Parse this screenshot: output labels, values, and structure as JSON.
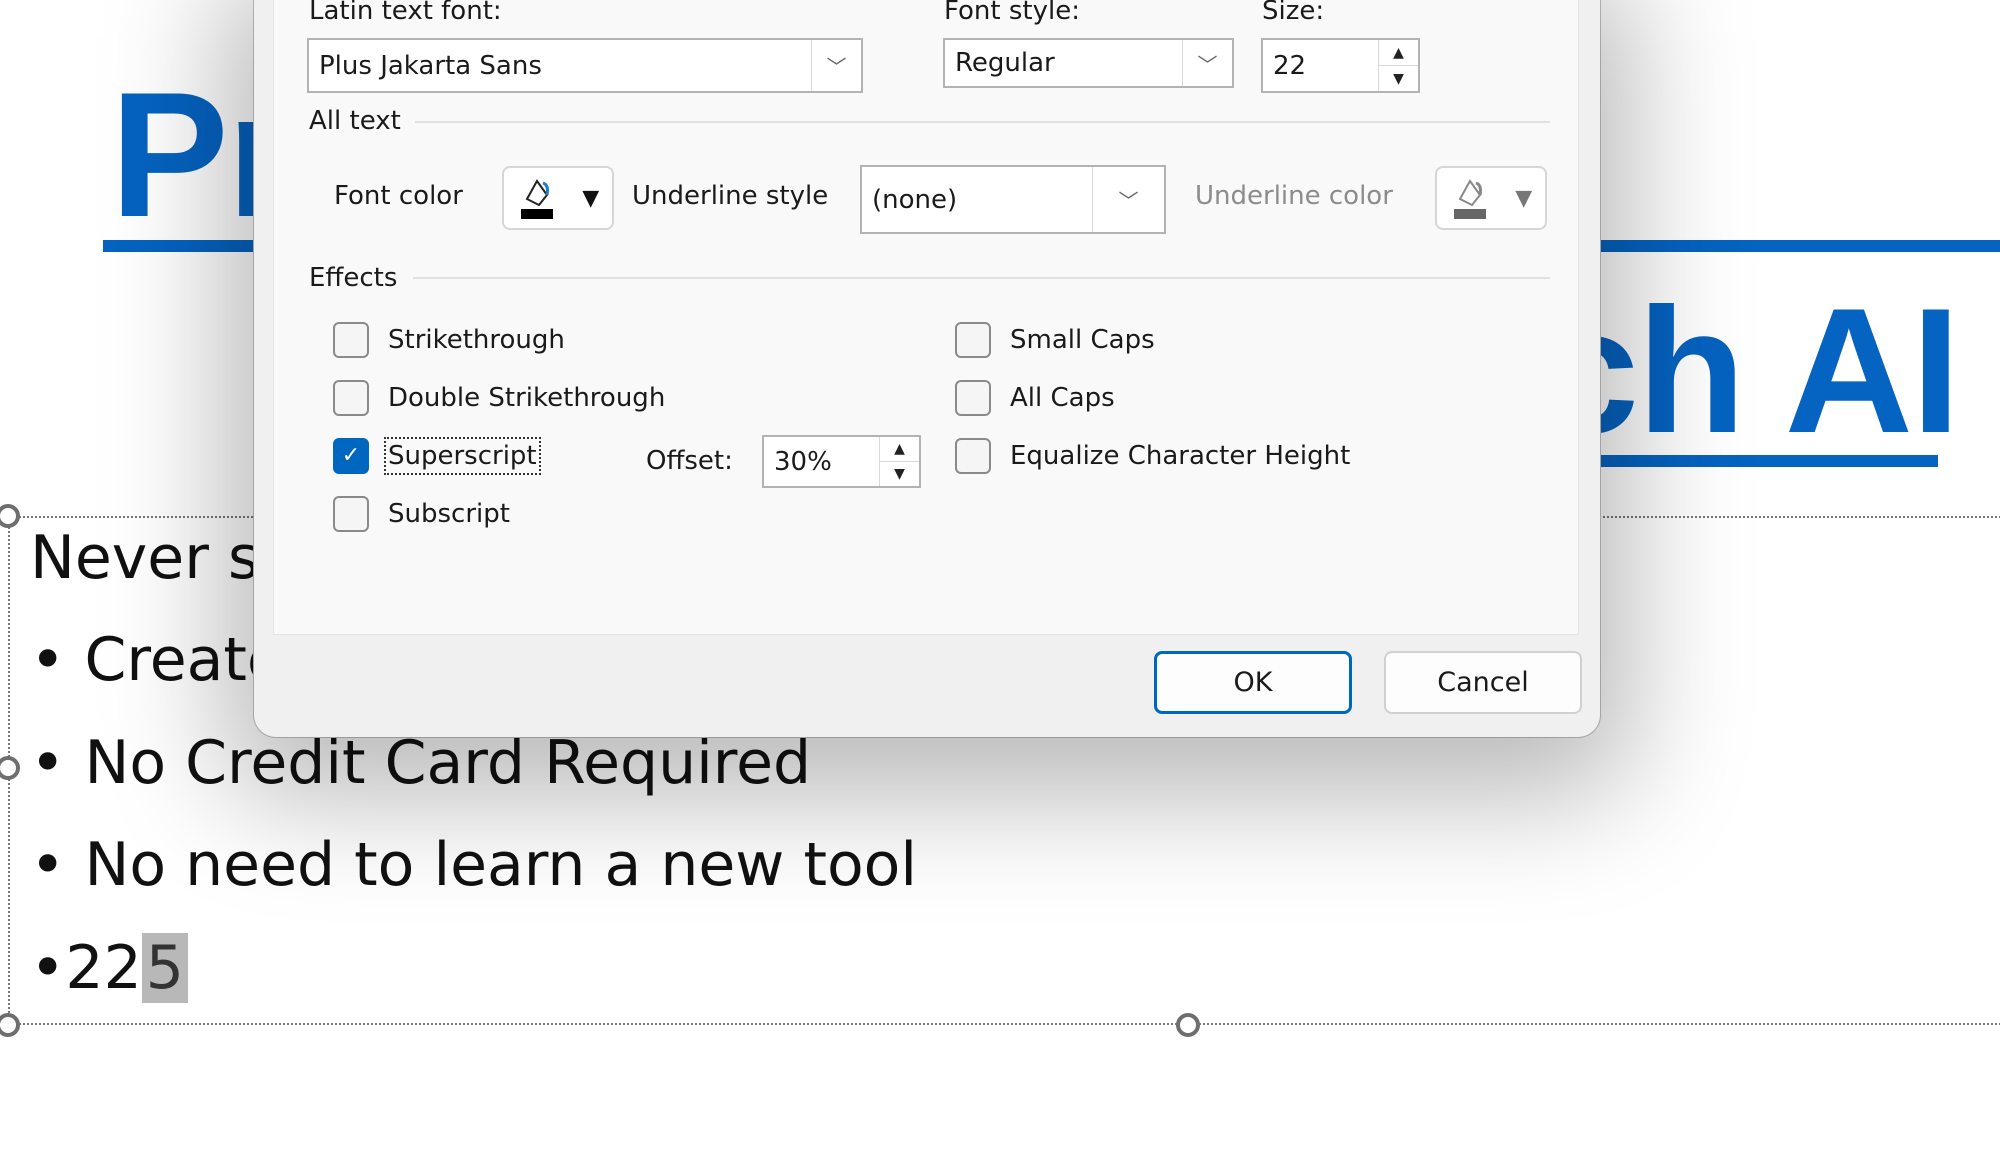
{
  "slide": {
    "title_line1": "Presentation",
    "title_line2": "ch AI",
    "title_color": "#0563C1",
    "body_lines": [
      "Never st",
      "• Create",
      "• No Credit Card Required",
      "• No need to learn a new tool"
    ],
    "last_line_prefix": "•22",
    "last_line_selected": "5"
  },
  "dialog": {
    "latin_font_label": "Latin text font:",
    "latin_font_value": "Plus Jakarta Sans",
    "font_style_label": "Font style:",
    "font_style_value": "Regular",
    "size_label": "Size:",
    "size_value": "22",
    "all_text_heading": "All text",
    "font_color_label": "Font color",
    "font_color_value": "#000000",
    "underline_style_label": "Underline style",
    "underline_style_value": "(none)",
    "underline_color_label": "Underline color",
    "effects_heading": "Effects",
    "effects": [
      {
        "label": "Strikethrough",
        "checked": false
      },
      {
        "label": "Double Strikethrough",
        "checked": false
      },
      {
        "label": "Superscript",
        "checked": true
      },
      {
        "label": "Subscript",
        "checked": false
      },
      {
        "label": "Small Caps",
        "checked": false
      },
      {
        "label": "All Caps",
        "checked": false
      },
      {
        "label": "Equalize Character Height",
        "checked": false
      }
    ],
    "offset_label": "Offset:",
    "offset_value": "30%",
    "ok_label": "OK",
    "cancel_label": "Cancel",
    "accent_color": "#0067C0"
  },
  "icons": {
    "check": "✓",
    "chevron_down": "﹀",
    "triangle_down": "▼",
    "spin_up": "▲",
    "spin_down": "▼"
  }
}
